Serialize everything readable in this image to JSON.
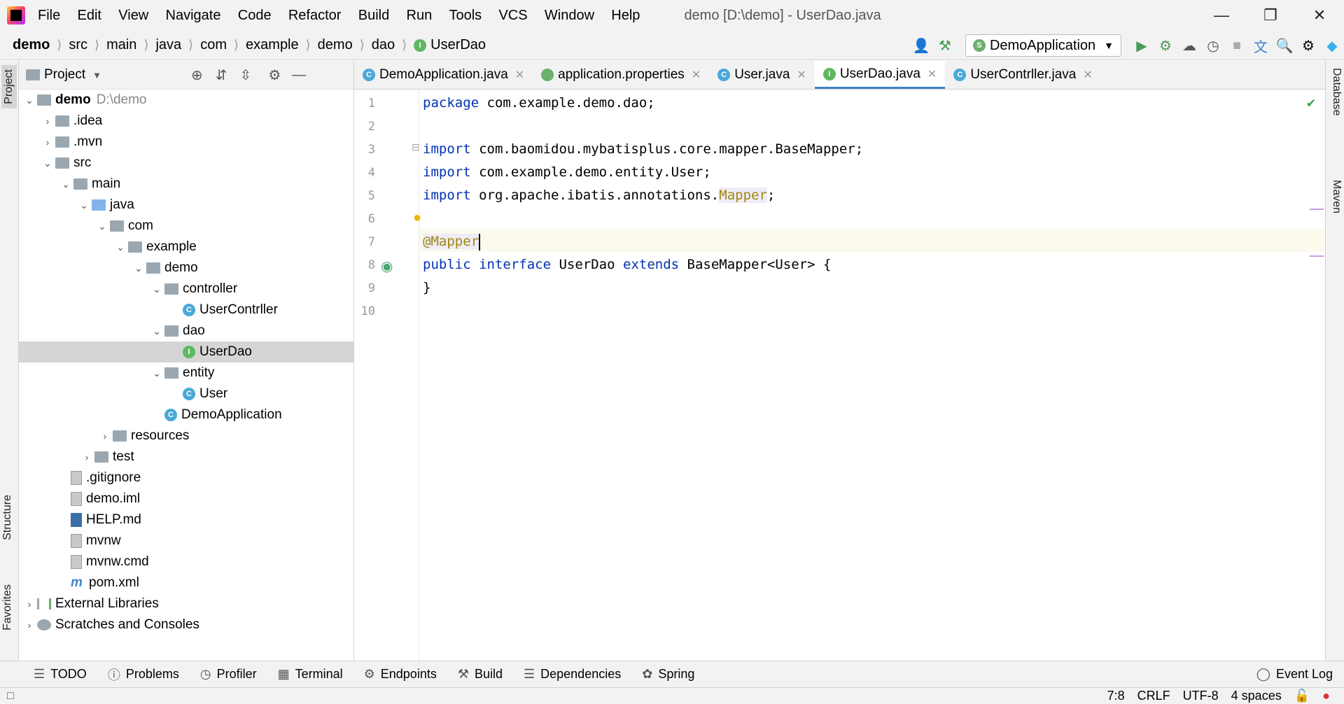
{
  "menu": [
    "File",
    "Edit",
    "View",
    "Navigate",
    "Code",
    "Refactor",
    "Build",
    "Run",
    "Tools",
    "VCS",
    "Window",
    "Help"
  ],
  "window_title": "demo [D:\\demo] - UserDao.java",
  "breadcrumb": [
    "demo",
    "src",
    "main",
    "java",
    "com",
    "example",
    "demo",
    "dao",
    "UserDao"
  ],
  "run_config": "DemoApplication",
  "project_panel": {
    "title": "Project"
  },
  "left_tabs": {
    "project": "Project",
    "structure": "Structure",
    "favorites": "Favorites"
  },
  "right_tabs": {
    "database": "Database",
    "maven": "Maven"
  },
  "tree": {
    "root": "demo",
    "root_path": "D:\\demo",
    "idea": ".idea",
    "mvn": ".mvn",
    "src": "src",
    "main": "main",
    "java": "java",
    "com": "com",
    "example": "example",
    "demo": "demo",
    "controller": "controller",
    "usercontrller": "UserContrller",
    "dao": "dao",
    "userdao": "UserDao",
    "entity": "entity",
    "user": "User",
    "demoapp": "DemoApplication",
    "resources": "resources",
    "test": "test",
    "gitignore": ".gitignore",
    "demoiml": "demo.iml",
    "help": "HELP.md",
    "mvnw": "mvnw",
    "mvnwcmd": "mvnw.cmd",
    "pom": "pom.xml",
    "extlib": "External Libraries",
    "scratches": "Scratches and Consoles"
  },
  "tabs": [
    "DemoApplication.java",
    "application.properties",
    "User.java",
    "UserDao.java",
    "UserContrller.java"
  ],
  "lines": [
    "1",
    "2",
    "3",
    "4",
    "5",
    "6",
    "7",
    "8",
    "9",
    "10"
  ],
  "code": {
    "l1a": "package",
    "l1b": " com.example.demo.dao;",
    "l3a": "import",
    "l3b": " com.baomidou.mybatisplus.core.mapper.BaseMapper;",
    "l4a": "import",
    "l4b": " com.example.demo.entity.User;",
    "l5a": "import",
    "l5b": " org.apache.ibatis.annotations.",
    "l5c": "Mapper",
    "l5d": ";",
    "l7": "@Mapper",
    "l8a": "public",
    "l8b": " ",
    "l8c": "interface",
    "l8d": " UserDao ",
    "l8e": "extends",
    "l8f": " BaseMapper<User> {",
    "l9": "}"
  },
  "bottom_tools": [
    "TODO",
    "Problems",
    "Profiler",
    "Terminal",
    "Endpoints",
    "Build",
    "Dependencies",
    "Spring"
  ],
  "event_log": "Event Log",
  "status": {
    "position": "7:8",
    "line_sep": "CRLF",
    "encoding": "UTF-8",
    "indent": "4 spaces"
  }
}
